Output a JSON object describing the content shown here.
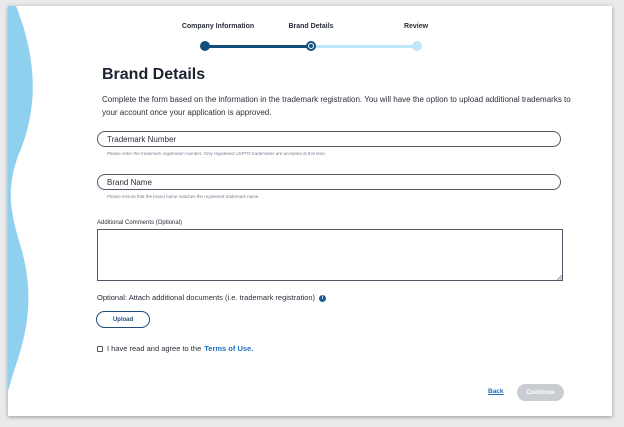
{
  "colors": {
    "accent_dark": "#114f7a",
    "accent_light": "#bfe6f7",
    "wave": "#8fd0ee",
    "link": "#1f6fc2",
    "disabled_button": "#c9ccd1"
  },
  "stepper": {
    "steps": [
      {
        "label": "Company Information",
        "state": "complete"
      },
      {
        "label": "Brand Details",
        "state": "current"
      },
      {
        "label": "Review",
        "state": "upcoming"
      }
    ]
  },
  "page": {
    "title": "Brand Details",
    "intro": "Complete the form based on the information in the trademark registration. You will have the option to upload additional trademarks to your account once your application is approved."
  },
  "form": {
    "trademark": {
      "placeholder": "Trademark Number",
      "value": "",
      "hint": "Please enter the trademark registration number. Only registered USPTO trademarks are accepted at this time."
    },
    "brand": {
      "placeholder": "Brand Name",
      "value": "",
      "hint": "Please ensure that the brand name matches the registered trademark name."
    },
    "comments": {
      "label": "Additional Comments (Optional)",
      "value": ""
    },
    "attach": {
      "label": "Optional: Attach additional documents (i.e. trademark registration)",
      "info_icon": "info-icon",
      "upload_label": "Upload"
    },
    "agree": {
      "checked": false,
      "text": "I have read and agree to the",
      "link": "Terms of Use."
    }
  },
  "footer": {
    "back_label": "Back",
    "continue_label": "Continue",
    "continue_enabled": false
  }
}
